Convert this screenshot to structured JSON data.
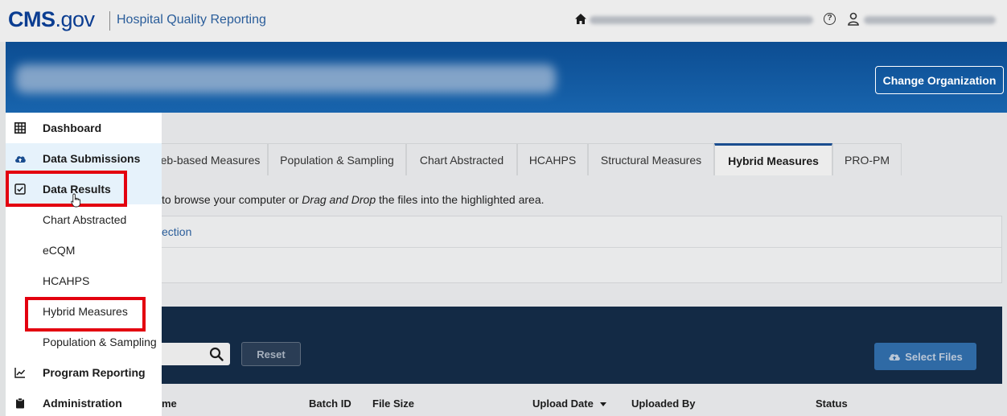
{
  "header": {
    "logo_bold": "CMS",
    "logo_rest": ".gov",
    "app_name": "Hospital Quality Reporting"
  },
  "banner": {
    "change_org_label": "Change Organization"
  },
  "tabs": [
    {
      "label": "eb-based Measures",
      "active": false
    },
    {
      "label": "Population & Sampling",
      "active": false
    },
    {
      "label": "Chart Abstracted",
      "active": false
    },
    {
      "label": "HCAHPS",
      "active": false
    },
    {
      "label": "Structural Measures",
      "active": false
    },
    {
      "label": "Hybrid Measures",
      "active": true
    },
    {
      "label": "PRO-PM",
      "active": false
    }
  ],
  "instruction": {
    "before": "to browse your computer or ",
    "italic": "Drag and Drop",
    "after": " the files into the highlighted area."
  },
  "panel": {
    "link_text": "ection"
  },
  "upload": {
    "reset_label": "Reset",
    "select_files_label": "Select Files"
  },
  "table_headers": {
    "name": "me",
    "batch_id": "Batch ID",
    "file_size": "File Size",
    "upload_date": "Upload Date",
    "uploaded_by": "Uploaded By",
    "status": "Status"
  },
  "sidebar": {
    "items": [
      {
        "label": "Dashboard",
        "icon": "grid-icon"
      },
      {
        "label": "Data Submissions",
        "icon": "cloud-upload-icon"
      },
      {
        "label": "Data Results",
        "icon": "checkbox-icon"
      },
      {
        "label": "Chart Abstracted"
      },
      {
        "label": "eCQM"
      },
      {
        "label": "HCAHPS"
      },
      {
        "label": "Hybrid Measures"
      },
      {
        "label": "Population & Sampling"
      },
      {
        "label": "Program Reporting",
        "icon": "line-chart-icon"
      },
      {
        "label": "Administration",
        "icon": "clipboard-icon"
      }
    ]
  },
  "colors": {
    "brand_blue": "#0b3d91",
    "banner_blue": "#0c4d92",
    "highlight_red": "#e3000f",
    "dark_panel": "#132a45"
  }
}
